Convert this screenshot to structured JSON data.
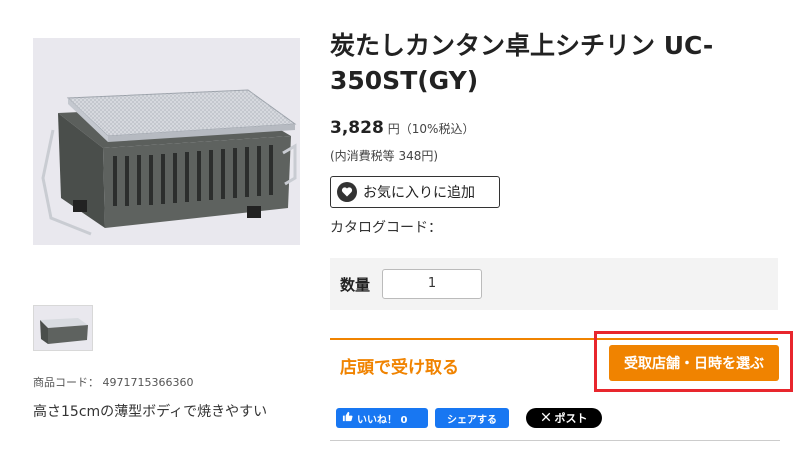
{
  "product": {
    "title": "炭たしカンタン卓上シチリン UC-350ST(GY)",
    "price": "3,828",
    "price_unit": "円（10%税込）",
    "tax_note": "(内消費税等 348円)",
    "code_label": "商品コード： 4971715366360",
    "description": "高さ15cmの薄型ボディで焼きやすい",
    "catalog_code_label": "カタログコード："
  },
  "favorite": {
    "label": "お気に入りに追加",
    "icon": "heart-icon"
  },
  "quantity": {
    "label": "数量",
    "value": "1"
  },
  "pickup": {
    "label": "店頭で受け取る",
    "button_label": "受取店舗・日時を選ぶ"
  },
  "share": {
    "like_label": "いいね！ 0",
    "share_label": "シェアする",
    "post_label": "ポスト"
  },
  "colors": {
    "accent": "#f08300",
    "highlight": "#e8262d",
    "facebook": "#1877f2"
  }
}
